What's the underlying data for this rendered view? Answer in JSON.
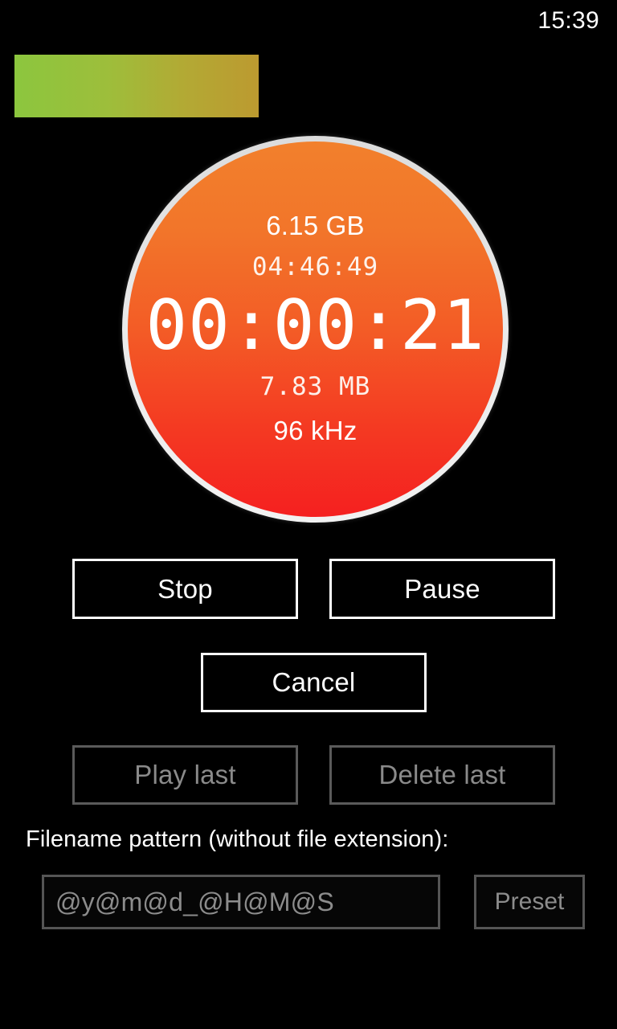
{
  "status_bar": {
    "clock": "15:39"
  },
  "level_meter": {
    "name": "audio-level-meter",
    "gradient_start_color": "#8CC63E",
    "gradient_end_color": "#BC9A30"
  },
  "timer_circle": {
    "ring_color": "#E6E6E6",
    "gradient_top_color": "#F2802C",
    "gradient_bottom_color": "#F52020",
    "space_free": "6.15 GB",
    "time_remaining": "04:46:49",
    "elapsed_time": "00:00:21",
    "file_size": "7.83 MB",
    "sample_rate": "96 kHz"
  },
  "controls": {
    "stop_label": "Stop",
    "pause_label": "Pause",
    "cancel_label": "Cancel",
    "play_last_label": "Play last",
    "delete_last_label": "Delete last"
  },
  "filename_section": {
    "label": "Filename pattern (without file extension):",
    "input_value": "@y@m@d_@H@M@S",
    "input_placeholder": "@y@m@d_@H@M@S",
    "preset_label": "Preset"
  }
}
